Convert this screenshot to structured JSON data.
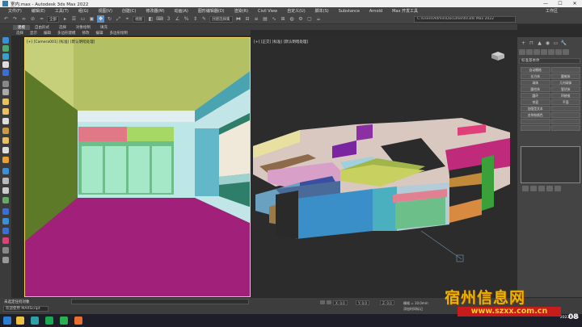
{
  "window": {
    "title": "室内.max - Autodesk 3ds Max 2022",
    "controls": [
      "—",
      "☐",
      "✕"
    ]
  },
  "menu": {
    "items": [
      "文件(F)",
      "编辑(E)",
      "工具(T)",
      "组(G)",
      "视图(V)",
      "创建(C)",
      "修改器(M)",
      "动画(A)",
      "图形编辑器(D)",
      "渲染(R)",
      "Civil View",
      "自定义(U)",
      "脚本(S)",
      "Substance",
      "Arnold",
      "Max 开发工具"
    ],
    "sign_in": "工作区"
  },
  "toolbar": {
    "filter": "全部",
    "view": "视图",
    "selection_set": "创建选择集",
    "path": "C:\\Users\\Admin\\Documents\\3ds Max 2022"
  },
  "ribbon": {
    "tabs": [
      "建模",
      "自由形式",
      "选择",
      "对象绘制",
      "填充"
    ],
    "selected": 0
  },
  "subribbon": {
    "items": [
      "选择",
      "显示",
      "编辑",
      "多边形建模",
      "修改",
      "编辑",
      "多边形绘制"
    ]
  },
  "viewports": {
    "left_label": "[+] [Camera001] [标准] [默认明暗处理]",
    "right_label": "[+] [正交] [标准] [默认明暗处理]"
  },
  "command_panel": {
    "tabs": [
      "+",
      "⊓",
      "▲",
      "◉",
      "▭",
      "🔧"
    ],
    "dropdown": "标准基本体",
    "section": "对象类型",
    "buttons": [
      "自动栅格",
      "",
      "长方体",
      "圆锥体",
      "球体",
      "几何球体",
      "圆柱体",
      "管状体",
      "圆环",
      "四棱锥",
      "茶壶",
      "平面",
      "加强型文本",
      "",
      "名称和颜色",
      "",
      "",
      "",
      "",
      ""
    ]
  },
  "status": {
    "selection": "未选定任何对象",
    "prompt": "单击或单击并拖动以选择对象",
    "x": "X: 0.0",
    "y": "Y: 0.0",
    "z": "Z: 0.0",
    "grid": "栅格 = 10.0mm",
    "add_time": "添加时间标记",
    "input": "欢迎使用 MAXScript"
  },
  "taskbar": {
    "time": "2023/1/26",
    "time_big": "08"
  },
  "watermark": {
    "title": "宿州信息网",
    "url": "www.szxx.com.cn"
  },
  "colors": {
    "accent": "#5b8fc7",
    "viewport_border": "#f0d060",
    "wall_green": "#5d7a28",
    "floor_magenta": "#a0207a",
    "ceiling": "#d8e0a0"
  }
}
